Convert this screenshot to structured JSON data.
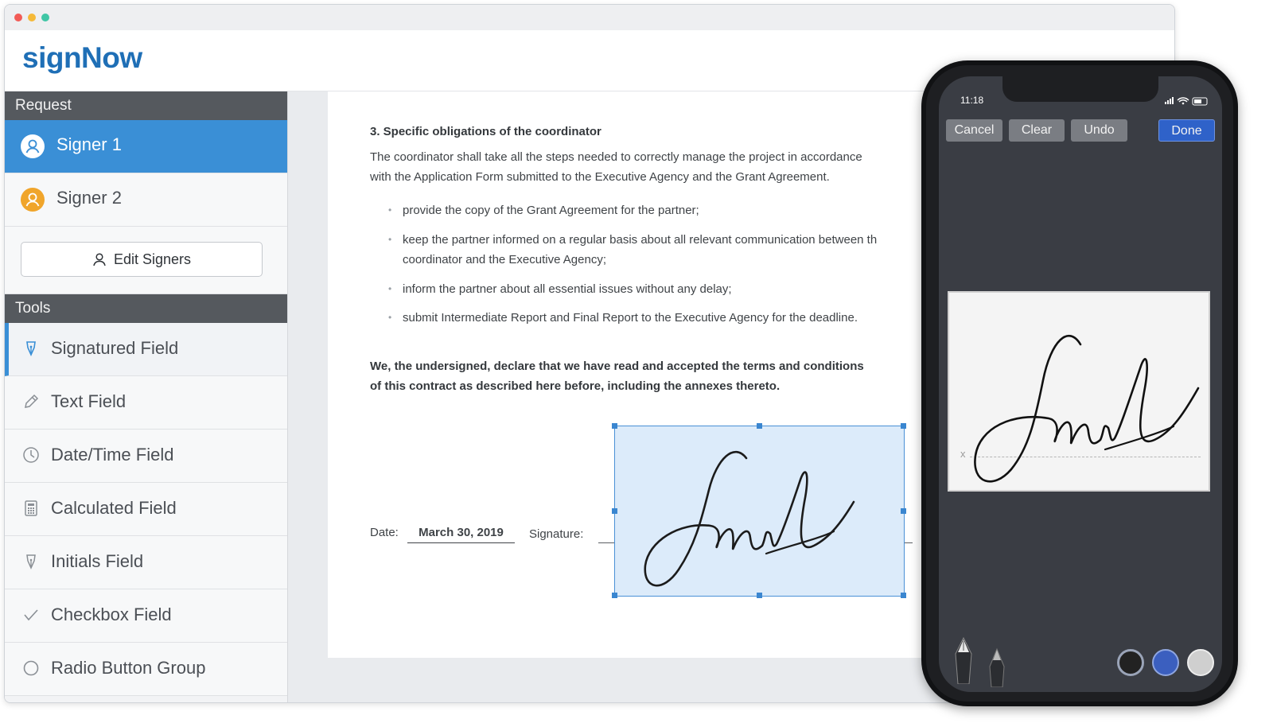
{
  "app": {
    "logo": "signNow"
  },
  "sidebar": {
    "request_header": "Request",
    "signers": [
      {
        "label": "Signer 1",
        "active": true,
        "color": "#3a8fd6"
      },
      {
        "label": "Signer 2",
        "active": false,
        "color": "#f0a52b"
      }
    ],
    "edit_signers_label": "Edit Signers",
    "tools_header": "Tools",
    "tools": [
      {
        "label": "Signatured Field",
        "icon": "pen-nib-icon",
        "active": true
      },
      {
        "label": "Text Field",
        "icon": "pencil-icon"
      },
      {
        "label": "Date/Time Field",
        "icon": "clock-icon"
      },
      {
        "label": "Calculated Field",
        "icon": "calculator-icon"
      },
      {
        "label": "Initials Field",
        "icon": "pen-nib-icon"
      },
      {
        "label": "Checkbox Field",
        "icon": "checkmark-icon"
      },
      {
        "label": "Radio Button Group",
        "icon": "radio-circle-icon"
      }
    ]
  },
  "document": {
    "heading": "3. Specific obligations of the coordinator",
    "para_line1": "The coordinator shall take all the steps needed to correctly manage the project in accordance",
    "para_line2": "with the Application Form submitted to the Executive Agency and the Grant Agreement.",
    "bullets": [
      "provide the copy of the Grant Agreement for the partner;",
      "keep the partner informed on a regular basis about all relevant communication between th",
      "coordinator and the Executive Agency;",
      "inform the partner about all essential issues without any delay;",
      "submit Intermediate Report and Final Report to the Executive Agency for the deadline."
    ],
    "declaration_line1": "We, the undersigned, declare that we have read and accepted the terms and conditions",
    "declaration_line2": "of this contract as described here before, including the annexes thereto.",
    "date_label": "Date:",
    "date_value": "March 30, 2019",
    "signature_label": "Signature:"
  },
  "phone": {
    "time": "11:18",
    "cancel": "Cancel",
    "clear": "Clear",
    "undo": "Undo",
    "done": "Done",
    "sign_line_mark": "x",
    "ink_colors": [
      "#222222",
      "#3b5fbf",
      "#cfcfcf"
    ],
    "selected_ink": "#222222"
  },
  "colors": {
    "accent": "#3a8fd6",
    "brand": "#1f6fb6"
  }
}
